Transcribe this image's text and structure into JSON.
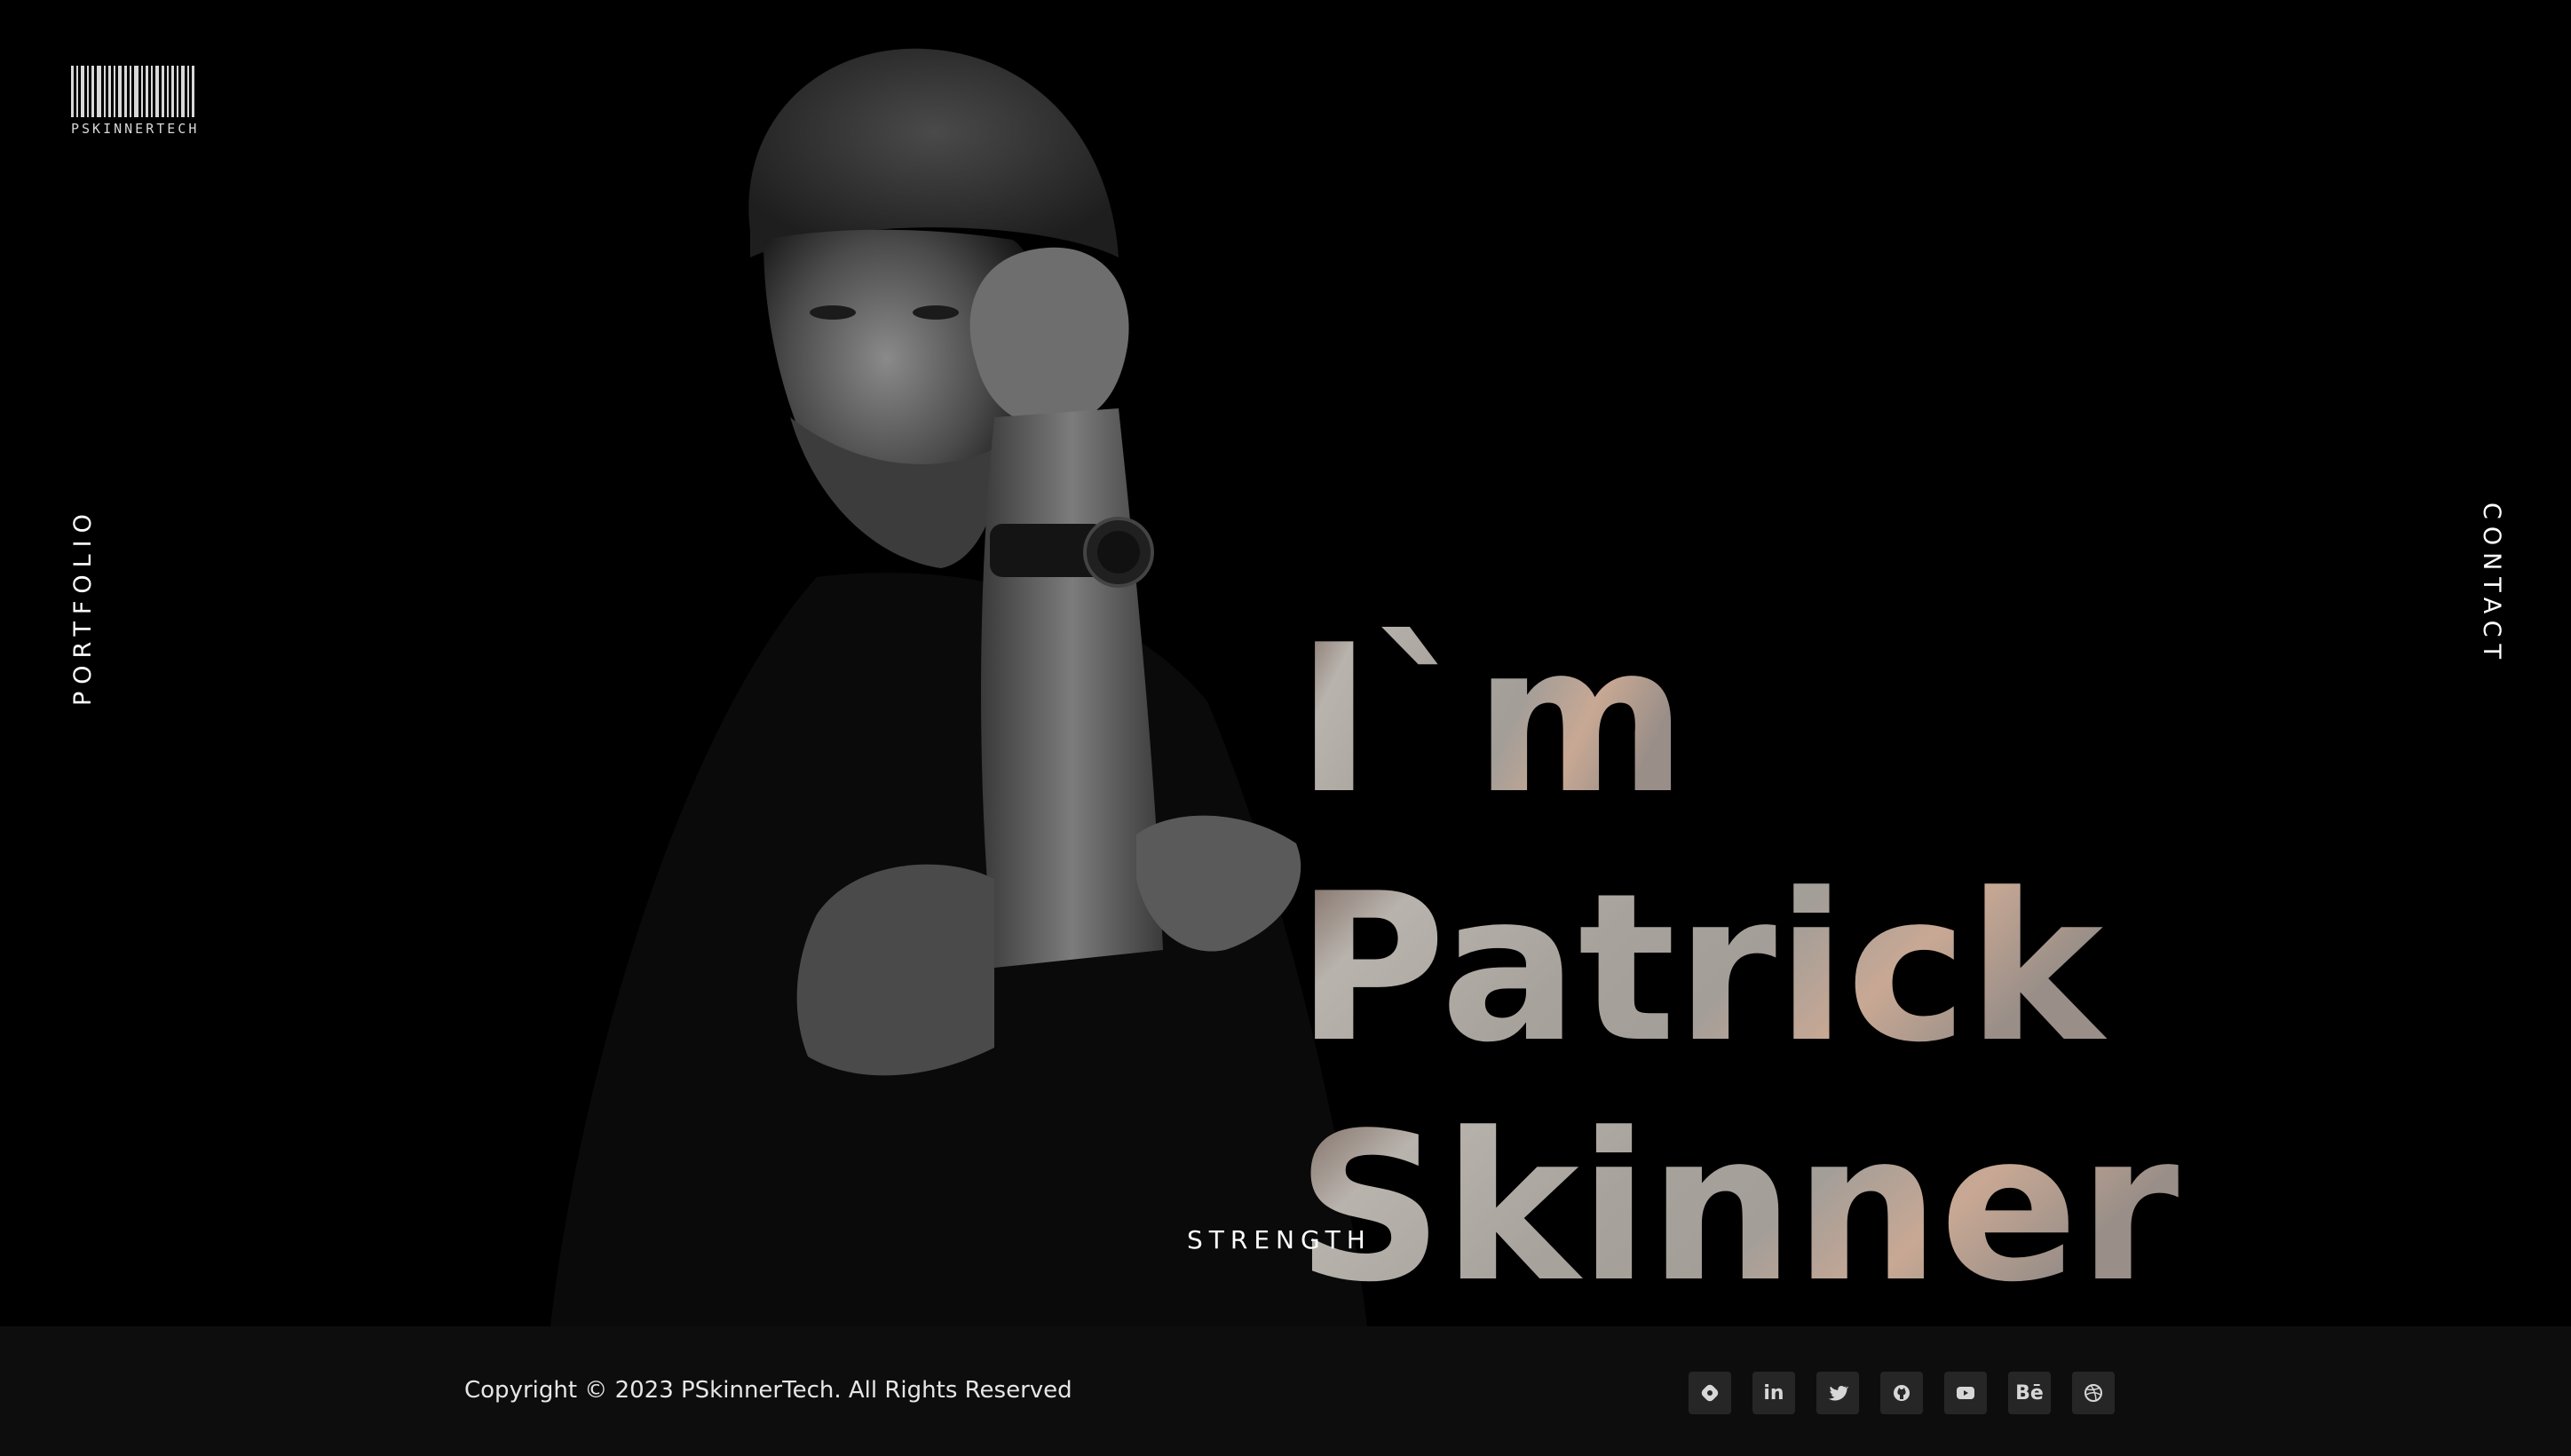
{
  "logo": {
    "text": "PSKINNERTECH"
  },
  "nav": {
    "left": "PORTFOLIO",
    "right": "CONTACT"
  },
  "hero": {
    "line1": "I`m",
    "line2": "Patrick",
    "line3": "Skinner",
    "tagline": "STRENGTH"
  },
  "footer": {
    "copyright": "Copyright © 2023 PSkinnerTech. All Rights Reserved",
    "social": [
      {
        "name": "hashnode-icon",
        "label": ""
      },
      {
        "name": "linkedin-icon",
        "label": "in"
      },
      {
        "name": "twitter-icon",
        "label": ""
      },
      {
        "name": "github-icon",
        "label": ""
      },
      {
        "name": "youtube-icon",
        "label": ""
      },
      {
        "name": "behance-icon",
        "label": "Bē"
      },
      {
        "name": "dribbble-icon",
        "label": ""
      }
    ]
  },
  "colors": {
    "background": "#000000",
    "footer": "#0d0d0d",
    "icon_bg": "#262626",
    "text": "#ffffff"
  }
}
